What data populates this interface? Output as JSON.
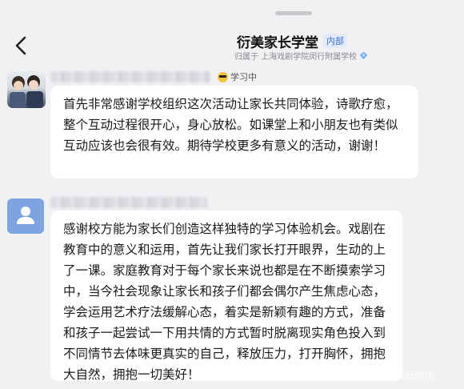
{
  "header": {
    "title": "衍美家长学堂",
    "tag": "内部",
    "subtitle": "归属于 上海戏剧学院闵行附属学校",
    "back_icon": "chevron-left-icon",
    "verify_icon": "diamond-badge-icon"
  },
  "messages": [
    {
      "status": "学习中",
      "status_icon": "sunglasses-emoji-icon",
      "text": "首先非常感谢学校组织这次活动让家长共同体验，诗歌疗愈，整个互动过程很开心，身心放松。如课堂上和小朋友也有类似互动应该也会很有效。期待学校更多有意义的活动，谢谢！"
    },
    {
      "avatar_icon": "default-user-avatar-icon",
      "text": "感谢校方能为家长们创造这样独特的学习体验机会。戏剧在教育中的意义和运用，首先让我们家长打开眼界，生动的上了一课。家庭教育对于每个家长来说也都是在不断摸索学习中，当今社会现象让家长和孩子们都会偶尔产生焦虑心态，学会运用艺术疗法缓解心态，着实是新颖有趣的方式，准备和孩子一起尝试一下用共情的方式暂时脱离现实角色投入到不同情节去体味更真实的自己，释放压力，打开胸怀，拥抱大自然，拥抱一切美好！"
    }
  ],
  "watermark": "华庭剧场",
  "colors": {
    "background": "#f1f1f4",
    "bubble": "#ffffff",
    "tag_text": "#3b6fd6",
    "tag_bg": "#e3ebfb",
    "avatar2": "#7da3e0"
  }
}
